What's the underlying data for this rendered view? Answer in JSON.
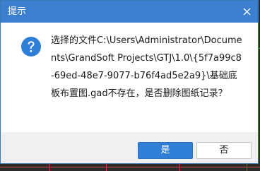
{
  "dialog": {
    "title": "提示",
    "message": "选择的文件C:\\Users\\Administrator\\Documents\\GrandSoft Projects\\GTJ\\1.0\\{5f7a99c8-69ed-48e7-9077-b76f4ad5e2a9}\\基础底板布置图.gad不存在，是否删除图纸记录？",
    "icon": "question-icon",
    "yes_label": "是",
    "no_label": "否"
  },
  "colors": {
    "titlebar": "#3c7fcf",
    "primary_button": "#2f7fd8",
    "background_window": "#2a2a2a"
  }
}
